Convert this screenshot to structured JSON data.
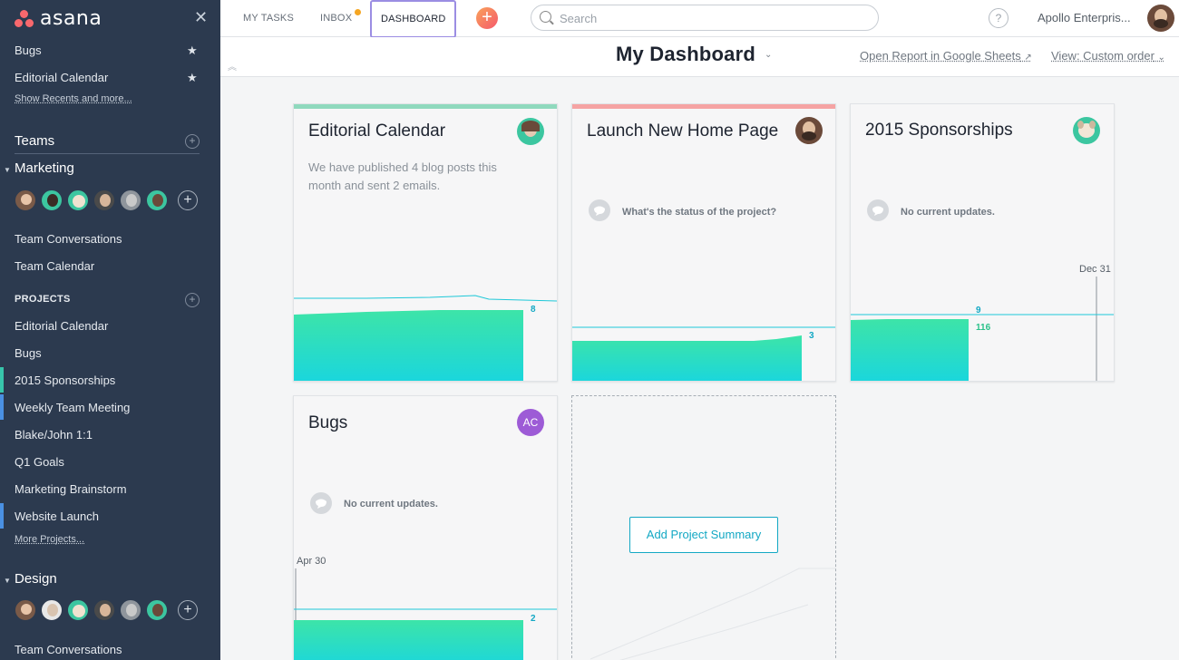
{
  "sidebar": {
    "logo_text": "asana",
    "favorites": [
      {
        "label": "Bugs"
      },
      {
        "label": "Editorial Calendar"
      }
    ],
    "show_recents": "Show Recents and more...",
    "teams_header": "Teams",
    "marketing_team": "Marketing",
    "marketing_links": [
      "Team Conversations",
      "Team Calendar"
    ],
    "projects_header": "PROJECTS",
    "projects": [
      {
        "label": "Editorial Calendar",
        "accent": ""
      },
      {
        "label": "Bugs",
        "accent": ""
      },
      {
        "label": "2015 Sponsorships",
        "accent": "#37c5ab"
      },
      {
        "label": "Weekly Team Meeting",
        "accent": "#4a90e2"
      },
      {
        "label": "Blake/John 1:1",
        "accent": ""
      },
      {
        "label": "Q1 Goals",
        "accent": ""
      },
      {
        "label": "Marketing Brainstorm",
        "accent": ""
      },
      {
        "label": "Website Launch",
        "accent": "#4a90e2"
      }
    ],
    "more_projects": "More Projects...",
    "design_team": "Design",
    "design_links": [
      "Team Conversations"
    ]
  },
  "topbar": {
    "tabs": [
      {
        "label": "MY TASKS"
      },
      {
        "label": "INBOX"
      },
      {
        "label": "DASHBOARD",
        "active": true
      }
    ],
    "search_placeholder": "Search",
    "help": "?",
    "org_name": "Apollo Enterpris..."
  },
  "header": {
    "title": "My Dashboard",
    "open_report": "Open Report in Google Sheets",
    "view": "View: Custom order"
  },
  "cards": [
    {
      "title": "Editorial Calendar",
      "color": "#8fd9bd",
      "description": "We have published 4 blog posts this month and sent 2 emails.",
      "chart_label": "8"
    },
    {
      "title": "Launch New Home Page",
      "color": "#f5a3a3",
      "status": "What's the status of the project?",
      "chart_label": "3"
    },
    {
      "title": "2015 Sponsorships",
      "status": "No current updates.",
      "date": "Dec 31",
      "line_label": "9",
      "chart_label": "116"
    },
    {
      "title": "Bugs",
      "avatar_initials": "AC",
      "status": "No current updates.",
      "date": "Apr 30",
      "chart_label": "2"
    }
  ],
  "add_summary": "Add Project Summary",
  "colors": {
    "sidebar_bg": "#2c3a4f",
    "accent_teal": "#13a8c4",
    "brand_coral": "#f8686d",
    "active_tab_border": "#9b8de3"
  }
}
